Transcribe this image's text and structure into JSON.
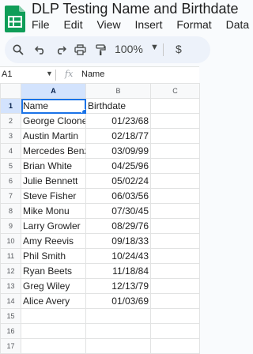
{
  "doc": {
    "title": "DLP Testing Name and Birthdate",
    "menu": [
      "File",
      "Edit",
      "View",
      "Insert",
      "Format",
      "Data"
    ]
  },
  "toolbar": {
    "zoom": "100%",
    "currency": "$"
  },
  "formula_bar": {
    "cell_ref": "A1",
    "fx": "fx",
    "value": "Name"
  },
  "sheet": {
    "columns": [
      "A",
      "B",
      "C"
    ],
    "row_numbers": [
      "1",
      "2",
      "3",
      "4",
      "5",
      "6",
      "7",
      "8",
      "9",
      "10",
      "11",
      "12",
      "13",
      "14",
      "15",
      "16",
      "17"
    ],
    "rows": [
      [
        "Name",
        "Birthdate"
      ],
      [
        "George Clooney",
        "01/23/68"
      ],
      [
        "Austin Martin",
        "02/18/77"
      ],
      [
        "Mercedes Benz",
        "03/09/99"
      ],
      [
        "Brian White",
        "04/25/96"
      ],
      [
        "Julie Bennett",
        "05/02/24"
      ],
      [
        "Steve Fisher",
        "06/03/56"
      ],
      [
        "Mike Monu",
        "07/30/45"
      ],
      [
        "Larry Growler",
        "08/29/76"
      ],
      [
        "Amy Reevis",
        "09/18/33"
      ],
      [
        "Phil Smith",
        "10/24/43"
      ],
      [
        "Ryan Beets",
        "11/18/84"
      ],
      [
        "Greg Wiley",
        "12/13/79"
      ],
      [
        "Alice Avery",
        "01/03/69"
      ],
      [
        "",
        ""
      ],
      [
        "",
        ""
      ],
      [
        "",
        ""
      ]
    ]
  },
  "colors": {
    "accent": "#1a73e8",
    "selection": "#d3e3fd",
    "logo": "#0f9d58"
  }
}
